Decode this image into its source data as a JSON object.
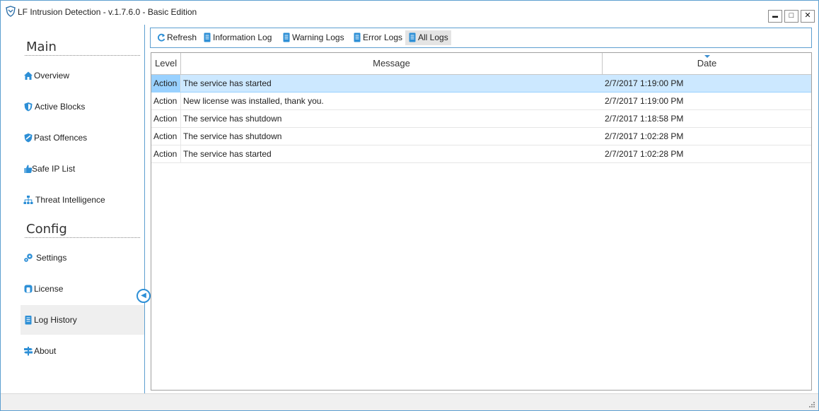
{
  "window": {
    "title": "LF Intrusion Detection - v.1.7.6.0 - Basic Edition",
    "min_glyph": "▬",
    "max_glyph": "□",
    "close_glyph": "✕"
  },
  "sidebar": {
    "main_title": "Main",
    "main_items": [
      {
        "label": "Overview",
        "icon": "home-icon"
      },
      {
        "label": "Active Blocks",
        "icon": "shield-icon"
      },
      {
        "label": "Past Offences",
        "icon": "shield-badge-icon"
      },
      {
        "label": "Safe IP List",
        "icon": "thumbs-up-icon"
      },
      {
        "label": "Threat Intelligence",
        "icon": "network-icon"
      }
    ],
    "config_title": "Config",
    "config_items": [
      {
        "label": "Settings",
        "icon": "gears-icon"
      },
      {
        "label": "License",
        "icon": "license-icon"
      },
      {
        "label": "Log History",
        "icon": "log-document-icon",
        "active": true
      },
      {
        "label": "About",
        "icon": "signpost-icon"
      }
    ]
  },
  "toolbar": {
    "refresh": "Refresh",
    "information_log": "Information Log",
    "warning_logs": "Warning Logs",
    "error_logs": "Error Logs",
    "all_logs": "All Logs"
  },
  "grid": {
    "columns": [
      "Level",
      "Message",
      "Date"
    ],
    "sorted_column": "Date",
    "rows": [
      {
        "level": "Action",
        "message": "The service has started",
        "date": "2/7/2017 1:19:00 PM",
        "selected": true
      },
      {
        "level": "Action",
        "message": "New license was installed, thank you.",
        "date": "2/7/2017 1:19:00 PM"
      },
      {
        "level": "Action",
        "message": "The service has shutdown",
        "date": "2/7/2017 1:18:58 PM"
      },
      {
        "level": "Action",
        "message": "The service has shutdown",
        "date": "2/7/2017 1:02:28 PM"
      },
      {
        "level": "Action",
        "message": "The service has started",
        "date": "2/7/2017 1:02:28 PM"
      }
    ]
  },
  "colors": {
    "accent": "#2d8fd6",
    "selection": "#cce8ff",
    "border": "#5d9fd0"
  }
}
